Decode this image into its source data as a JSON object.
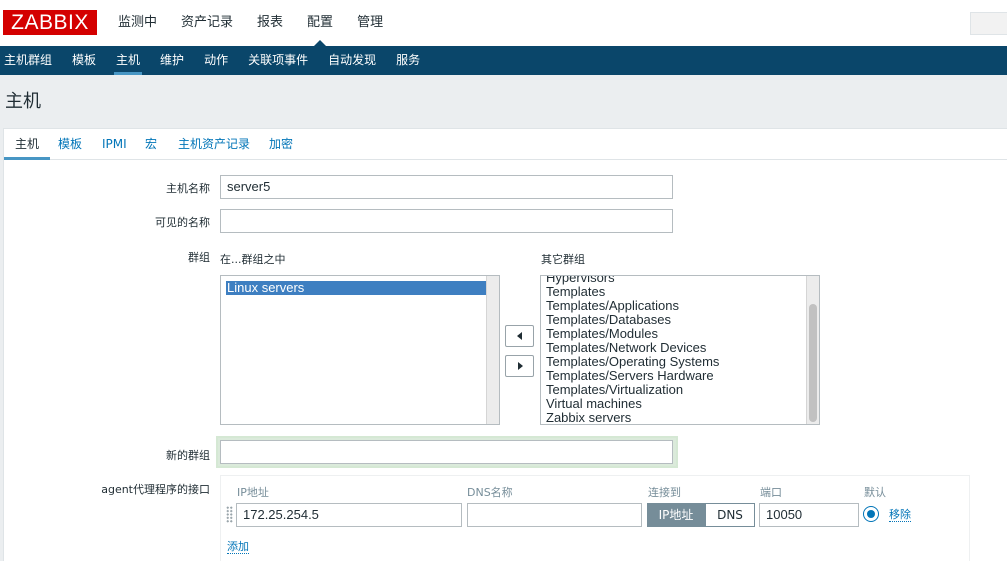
{
  "logo": "ZABBIX",
  "topnav": [
    "监测中",
    "资产记录",
    "报表",
    "配置",
    "管理"
  ],
  "subnav": [
    "主机群组",
    "模板",
    "主机",
    "维护",
    "动作",
    "关联项事件",
    "自动发现",
    "服务"
  ],
  "page_title": "主机",
  "tabs": [
    "主机",
    "模板",
    "IPMI",
    "宏",
    "主机资产记录",
    "加密"
  ],
  "form": {
    "hostname_label": "主机名称",
    "hostname_value": "server5",
    "visible_name_label": "可见的名称",
    "visible_name_value": "",
    "groups_label": "群组",
    "in_groups_label": "在...群组之中",
    "other_groups_label": "其它群组",
    "in_groups": [
      "Linux servers"
    ],
    "other_groups": [
      "Hypervisors",
      "Templates",
      "Templates/Applications",
      "Templates/Databases",
      "Templates/Modules",
      "Templates/Network Devices",
      "Templates/Operating Systems",
      "Templates/Servers Hardware",
      "Templates/Virtualization",
      "Virtual machines",
      "Zabbix servers"
    ],
    "new_group_label": "新的群组",
    "new_group_value": "",
    "agent_iface_label": "agent代理程序的接口"
  },
  "interface": {
    "headers": {
      "ip": "IP地址",
      "dns": "DNS名称",
      "connect": "连接到",
      "port": "端口",
      "default": "默认"
    },
    "ip": "172.25.254.5",
    "dns": "",
    "connect_ip": "IP地址",
    "connect_dns": "DNS",
    "port": "10050",
    "remove": "移除",
    "add": "添加"
  },
  "colors": {
    "brand": "#d40000",
    "subnav": "#0a466a",
    "link": "#0275b8",
    "selected": "#3e7fc1"
  }
}
